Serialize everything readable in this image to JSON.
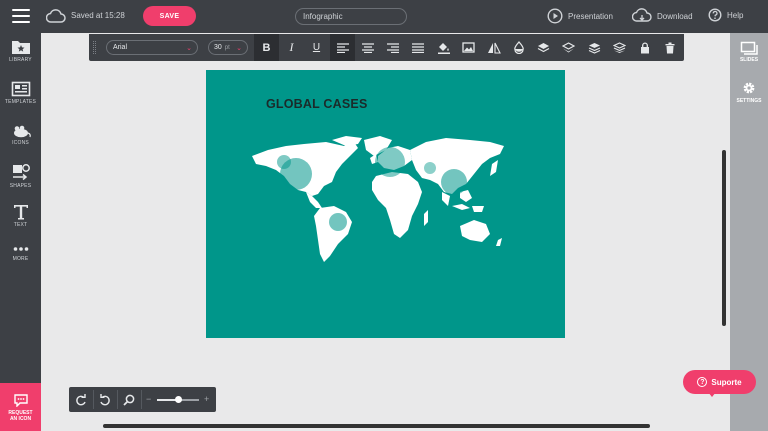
{
  "topbar": {
    "saved_text": "Saved at 15:28",
    "save_label": "SAVE",
    "title_value": "Infographic",
    "presentation_label": "Presentation",
    "download_label": "Download",
    "help_label": "Help"
  },
  "left_sidebar": {
    "items": [
      {
        "label": "LIBRARY",
        "icon": "library-icon"
      },
      {
        "label": "TEMPLATES",
        "icon": "templates-icon"
      },
      {
        "label": "ICONS",
        "icon": "mouse-icon"
      },
      {
        "label": "SHAPES",
        "icon": "shapes-icon"
      },
      {
        "label": "TEXT",
        "icon": "text-icon"
      },
      {
        "label": "MORE",
        "icon": "more-icon"
      }
    ],
    "request_line1": "REQUEST",
    "request_line2": "AN ICON"
  },
  "right_sidebar": {
    "slides_label": "SLIDES",
    "settings_label": "SETTINGS"
  },
  "format_toolbar": {
    "font_family": "Arial",
    "font_size": "30",
    "font_size_unit": "pt",
    "bold": "B",
    "italic": "I",
    "underline": "U"
  },
  "canvas": {
    "title": "GLOBAL CASES",
    "background_color": "#00968a"
  },
  "zoom": {
    "minus": "−",
    "plus": "+",
    "level": 0.5
  },
  "support": {
    "label": "Suporte",
    "icon": "?"
  },
  "colors": {
    "accent": "#f03e6c",
    "chrome": "#3d4045",
    "canvas": "#00968a"
  }
}
